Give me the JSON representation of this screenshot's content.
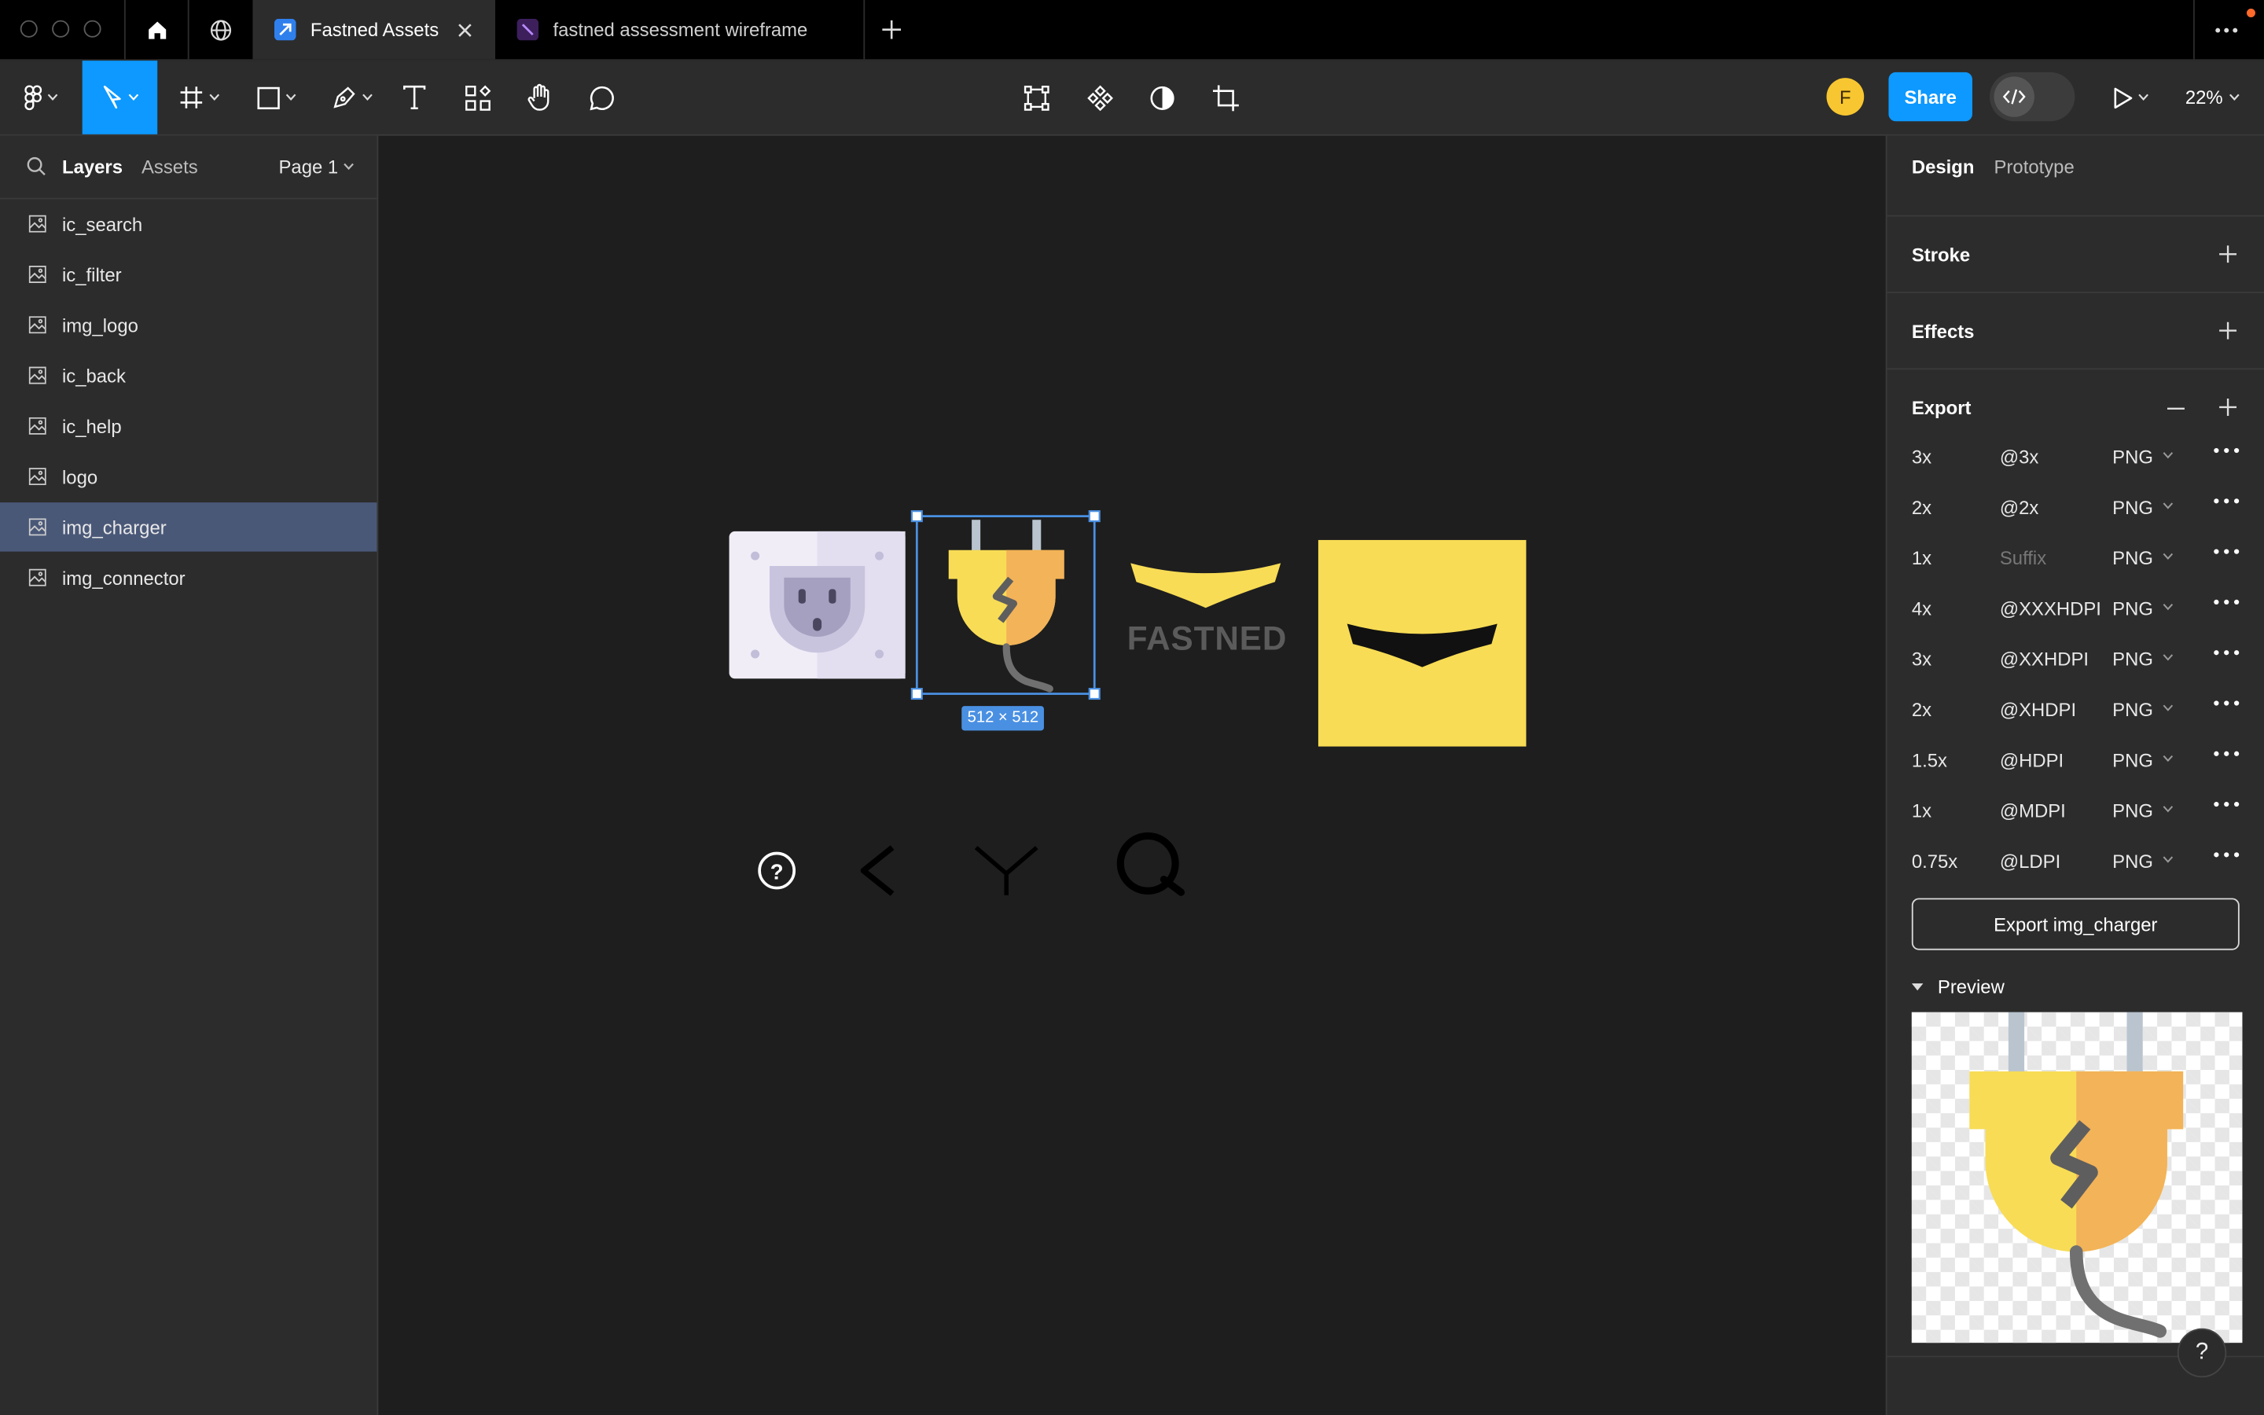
{
  "tabs": [
    {
      "label": "Fastned Assets",
      "active": true
    },
    {
      "label": "fastned assessment wireframe",
      "active": false
    }
  ],
  "toolbar": {
    "avatar_initial": "F",
    "share_label": "Share",
    "zoom": "22%"
  },
  "left_panel": {
    "tab_layers": "Layers",
    "tab_assets": "Assets",
    "page": "Page 1",
    "layers": [
      {
        "name": "ic_search",
        "selected": false
      },
      {
        "name": "ic_filter",
        "selected": false
      },
      {
        "name": "img_logo",
        "selected": false
      },
      {
        "name": "ic_back",
        "selected": false
      },
      {
        "name": "ic_help",
        "selected": false
      },
      {
        "name": "logo",
        "selected": false
      },
      {
        "name": "img_charger",
        "selected": true
      },
      {
        "name": "img_connector",
        "selected": false
      }
    ]
  },
  "canvas": {
    "selection_size": "512 × 512",
    "logo_wordmark": "FASTNED",
    "colors": {
      "brand_yellow": "#f8dc55",
      "selection_blue": "#4a90e2",
      "plug_orange": "#f3b358"
    }
  },
  "right_panel": {
    "tab_design": "Design",
    "tab_prototype": "Prototype",
    "stroke_label": "Stroke",
    "effects_label": "Effects",
    "export_label": "Export",
    "export_rows": [
      {
        "scale": "3x",
        "suffix": "@3x",
        "format": "PNG"
      },
      {
        "scale": "2x",
        "suffix": "@2x",
        "format": "PNG"
      },
      {
        "scale": "1x",
        "suffix": "",
        "suffix_placeholder": "Suffix",
        "format": "PNG"
      },
      {
        "scale": "4x",
        "suffix": "@XXXHDPI",
        "format": "PNG"
      },
      {
        "scale": "3x",
        "suffix": "@XXHDPI",
        "format": "PNG"
      },
      {
        "scale": "2x",
        "suffix": "@XHDPI",
        "format": "PNG"
      },
      {
        "scale": "1.5x",
        "suffix": "@HDPI",
        "format": "PNG"
      },
      {
        "scale": "1x",
        "suffix": "@MDPI",
        "format": "PNG"
      },
      {
        "scale": "0.75x",
        "suffix": "@LDPI",
        "format": "PNG"
      }
    ],
    "export_button": "Export img_charger",
    "preview_label": "Preview"
  },
  "help_label": "?"
}
